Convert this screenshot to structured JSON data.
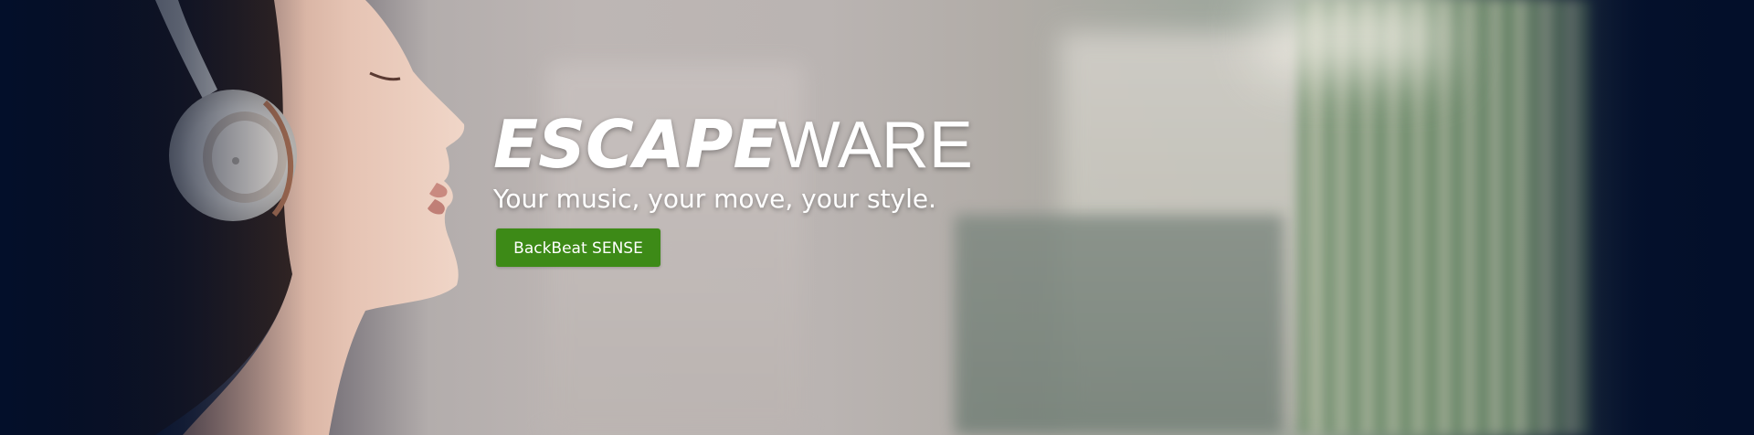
{
  "hero": {
    "headline_bold": "ESCAPE",
    "headline_light": "WARE",
    "tagline": "Your music, your move, your style.",
    "cta_label": "BackBeat SENSE"
  },
  "colors": {
    "background": "#030f2a",
    "cta": "#3d8a17",
    "text": "#ffffff"
  }
}
